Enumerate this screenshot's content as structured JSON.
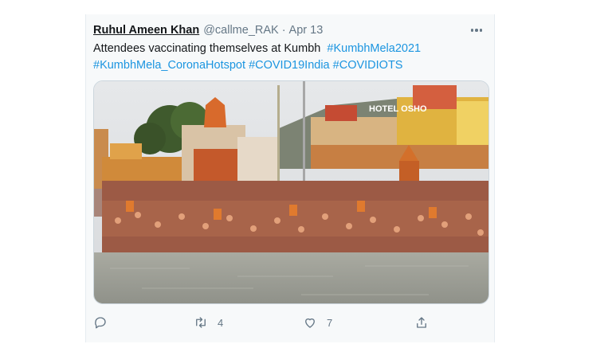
{
  "tweet": {
    "author_name": "Ruhul Ameen Khan",
    "handle": "@callme_RAK",
    "separator": "·",
    "date": "Apr 13",
    "text": "Attendees vaccinating themselves at Kumbh",
    "hashtags": [
      "#KumbhMela2021",
      "#KumbhMela_CoronaHotspot",
      "#COVID19India",
      "#COVIDIOTS"
    ],
    "photo_sign": "HOTEL OSHO",
    "photo_alt": "photo-of-crowd-bathing-in-river",
    "replies": "",
    "retweets": "4",
    "likes": "7",
    "icons": {
      "more": "more-horizontal-icon",
      "reply": "reply-icon",
      "retweet": "retweet-icon",
      "like": "heart-icon",
      "share": "share-icon"
    }
  },
  "colors": {
    "text": "#14171a",
    "secondary": "#657786",
    "link": "#1b95e0",
    "card_bg": "#f7f9fa"
  }
}
